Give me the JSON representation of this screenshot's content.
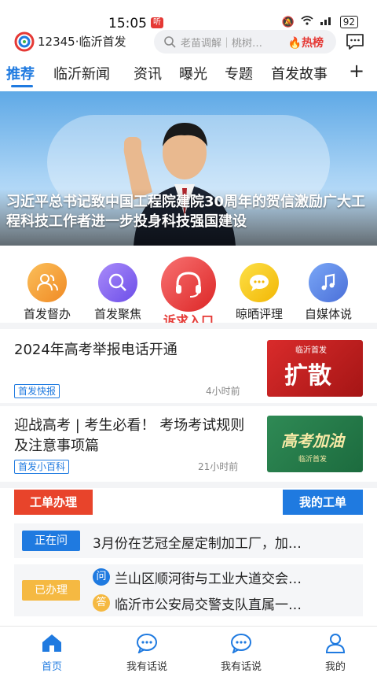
{
  "status_bar": {
    "time": "15:05",
    "notification_badge": "听",
    "battery": "92"
  },
  "header": {
    "app_name": "12345·临沂首发",
    "search_placeholder": "老苗调解｜桃树…",
    "hot_label": "热榜"
  },
  "tabs": [
    {
      "label": "推荐",
      "active": true
    },
    {
      "label": "临沂新闻"
    },
    {
      "label": "资讯"
    },
    {
      "label": "曝光"
    },
    {
      "label": "专题"
    },
    {
      "label": "首发故事"
    }
  ],
  "tab_add": "+",
  "banner": {
    "title": "习近平总书记致中国工程院建院30周年的贺信激励广大工程科技工作者进一步投身科技强国建设",
    "slide_index": 3,
    "slide_count": 4
  },
  "shortcuts": [
    {
      "label": "首发督办",
      "icon": "users-icon",
      "color": "#f7a23b"
    },
    {
      "label": "首发聚焦",
      "icon": "search-icon",
      "color": "#8b6cf6"
    },
    {
      "label": "诉求入口",
      "icon": "headset-icon",
      "color": "#ef4444"
    },
    {
      "label": "晾晒评理",
      "icon": "chat-dots-icon",
      "color": "#f5c21b"
    },
    {
      "label": "自媒体说",
      "icon": "music-note-icon",
      "color": "#5b8def"
    }
  ],
  "news": [
    {
      "title": "2024年高考举报电话开通",
      "tag": "首发快报",
      "time": "4小时前",
      "thumb_caption": "扩散",
      "thumb_brand": "临沂首发"
    },
    {
      "title": "迎战高考 | 考生必看！ 考场考试规则及注意事项篇",
      "tag": "首发小百科",
      "time": "21小时前",
      "thumb_caption": "高考加油",
      "thumb_brand": "临沂首发"
    }
  ],
  "work_orders": {
    "title": "工单办理",
    "mine_label": "我的工单",
    "in_progress": {
      "status": "正在问",
      "text": "3月份在艺冠全屋定制加工厂，加…"
    },
    "done": {
      "status": "已办理",
      "q_mark": "问",
      "a_mark": "答",
      "question": "兰山区顺河街与工业大道交会…",
      "answer": "临沂市公安局交警支队直属一…"
    }
  },
  "tabbar": [
    {
      "label": "首页",
      "icon": "home-icon",
      "active": true
    },
    {
      "label": "我有话说",
      "icon": "chat-bubble-icon"
    },
    {
      "label": "我有话说",
      "icon": "chat-bubble-icon"
    },
    {
      "label": "我的",
      "icon": "user-icon"
    }
  ],
  "colors": {
    "accent": "#1f7ae0",
    "red": "#e8442b",
    "done": "#f5b942"
  }
}
